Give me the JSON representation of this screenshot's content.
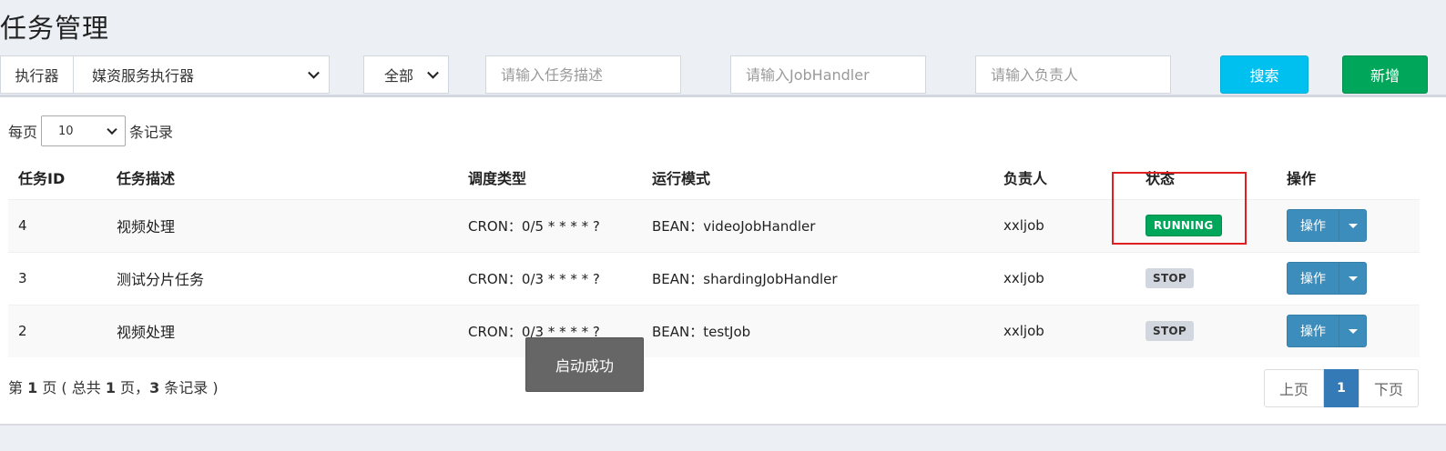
{
  "page": {
    "title": "任务管理"
  },
  "filters": {
    "executor_label": "执行器",
    "executor_value": "媒资服务执行器",
    "status_value": "全部",
    "desc_placeholder": "请输入任务描述",
    "handler_placeholder": "请输入JobHandler",
    "author_placeholder": "请输入负责人",
    "search_label": "搜索",
    "add_label": "新增"
  },
  "per_page": {
    "prefix": "每页",
    "value": "10",
    "suffix": "条记录"
  },
  "table": {
    "headers": [
      "任务ID",
      "任务描述",
      "调度类型",
      "运行模式",
      "负责人",
      "状态",
      "操作"
    ],
    "rows": [
      {
        "id": "4",
        "desc": "视频处理",
        "schedule": "CRON：0/5 * * * * ?",
        "mode": "BEAN：videoJobHandler",
        "author": "xxljob",
        "status": "RUNNING",
        "op": "操作"
      },
      {
        "id": "3",
        "desc": "测试分片任务",
        "schedule": "CRON：0/3 * * * * ?",
        "mode": "BEAN：shardingJobHandler",
        "author": "xxljob",
        "status": "STOP",
        "op": "操作"
      },
      {
        "id": "2",
        "desc": "视频处理",
        "schedule": "CRON：0/3 * * * * ?",
        "mode": "BEAN：testJob",
        "author": "xxljob",
        "status": "STOP",
        "op": "操作"
      }
    ]
  },
  "pager": {
    "info_pre": "第 ",
    "page": "1",
    "info_mid1": " 页 ( 总共 ",
    "total_pages": "1",
    "info_mid2": " 页，",
    "total_records": "3",
    "info_post": " 条记录 )",
    "prev": "上页",
    "current": "1",
    "next": "下页"
  },
  "toast": {
    "message": "启动成功"
  },
  "colors": {
    "running": "#00a65a",
    "stop": "#d2d6de",
    "primary": "#3c8dbc",
    "search": "#00c0ef",
    "add": "#00a65a",
    "highlight": "#e02020"
  }
}
